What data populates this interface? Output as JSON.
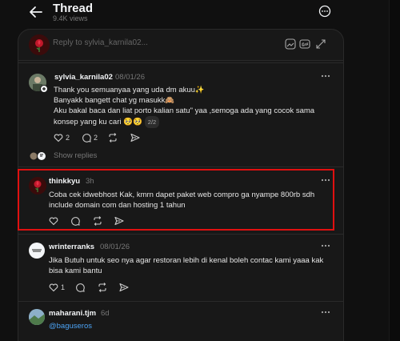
{
  "header": {
    "title": "Thread",
    "views": "9.4K views"
  },
  "reply_bar": {
    "placeholder": "Reply to sylvia_karnila02..."
  },
  "posts": [
    {
      "username": "sylvia_karnila02",
      "date": "08/01/26",
      "lines": [
        "Thank you semuanyaa yang uda dm akuu✨",
        "Banyakk bangett chat yg masukk🙈",
        "Aku bakal baca dan liat porto kalian satu\" yaa ,semoga ada yang cocok sama",
        "konsep yang ku cari 🥺🥺"
      ],
      "page_badge": "2/2",
      "likes": "2",
      "replies": "2",
      "show_replies": "Show replies"
    },
    {
      "username": "thinkkyu",
      "date": "3h",
      "lines": [
        "Coba cek idwebhost Kak, kmrn dapet paket web compro ga nyampe 800rb sdh",
        "include domain com dan hosting 1 tahun"
      ]
    },
    {
      "username": "wrinterranks",
      "date": "08/01/26",
      "lines": [
        "Jika Butuh untuk seo nya agar restoran lebih di kenal boleh contac kami yaaa kak",
        "bisa kami bantu"
      ],
      "likes": "1"
    },
    {
      "username": "maharani.tjm",
      "date": "6d",
      "mention": "@baguseros"
    }
  ],
  "colors": {
    "background": "#101010",
    "panel": "#181818",
    "highlight": "#e01010",
    "mention": "#4ca3f5"
  }
}
